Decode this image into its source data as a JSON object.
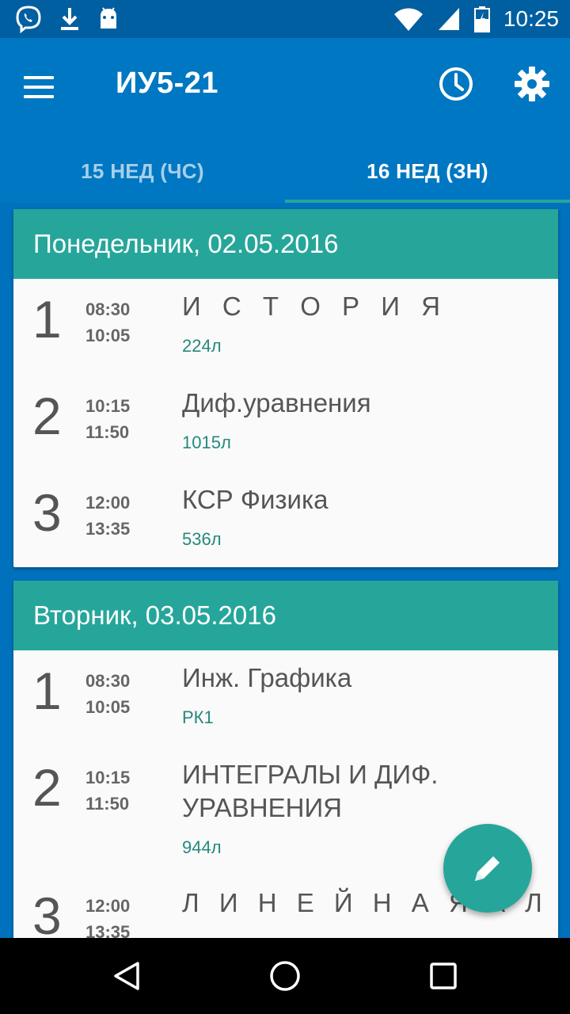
{
  "status_bar": {
    "time": "10:25",
    "left_icons": [
      "viber-icon",
      "download-icon",
      "android-icon"
    ],
    "right_icons": [
      "wifi-icon",
      "signal-icon",
      "battery-charging-icon"
    ]
  },
  "app_bar": {
    "title": "ИУ5-21",
    "icons": [
      "menu-icon",
      "clock-icon",
      "settings-icon"
    ]
  },
  "tabs": [
    {
      "label": "15  НЕД (ЧС)",
      "active": false
    },
    {
      "label": "16  НЕД (ЗН)",
      "active": true
    }
  ],
  "days": [
    {
      "header": "Понедельник, 02.05.2016",
      "lessons": [
        {
          "num": "1",
          "start": "08:30",
          "end": "10:05",
          "subject": "И С Т О Р И Я",
          "room": "224л"
        },
        {
          "num": "2",
          "start": "10:15",
          "end": "11:50",
          "subject": "Диф.уравнения",
          "room": "1015л"
        },
        {
          "num": "3",
          "start": "12:00",
          "end": "13:35",
          "subject": "КСР Физика",
          "room": "536л"
        }
      ]
    },
    {
      "header": "Вторник, 03.05.2016",
      "lessons": [
        {
          "num": "1",
          "start": "08:30",
          "end": "10:05",
          "subject": "Инж. Графика",
          "room": "РК1"
        },
        {
          "num": "2",
          "start": "10:15",
          "end": "11:50",
          "subject": "ИНТЕГРАЛЫ И ДИФ. УРАВНЕНИЯ",
          "room": "944л"
        },
        {
          "num": "3",
          "start": "12:00",
          "end": "13:35",
          "subject": "Л И Н Е Й Н А Я А Л Г Е Б Р",
          "room": ""
        }
      ]
    }
  ],
  "fab": {
    "icon": "pencil-icon"
  },
  "nav_bar": {
    "icons": [
      "back-icon",
      "home-icon",
      "recents-icon"
    ]
  },
  "colors": {
    "primary": "#0077C2",
    "status_bar": "#005FA0",
    "accent": "#26A69A",
    "room_text": "#26897E"
  }
}
